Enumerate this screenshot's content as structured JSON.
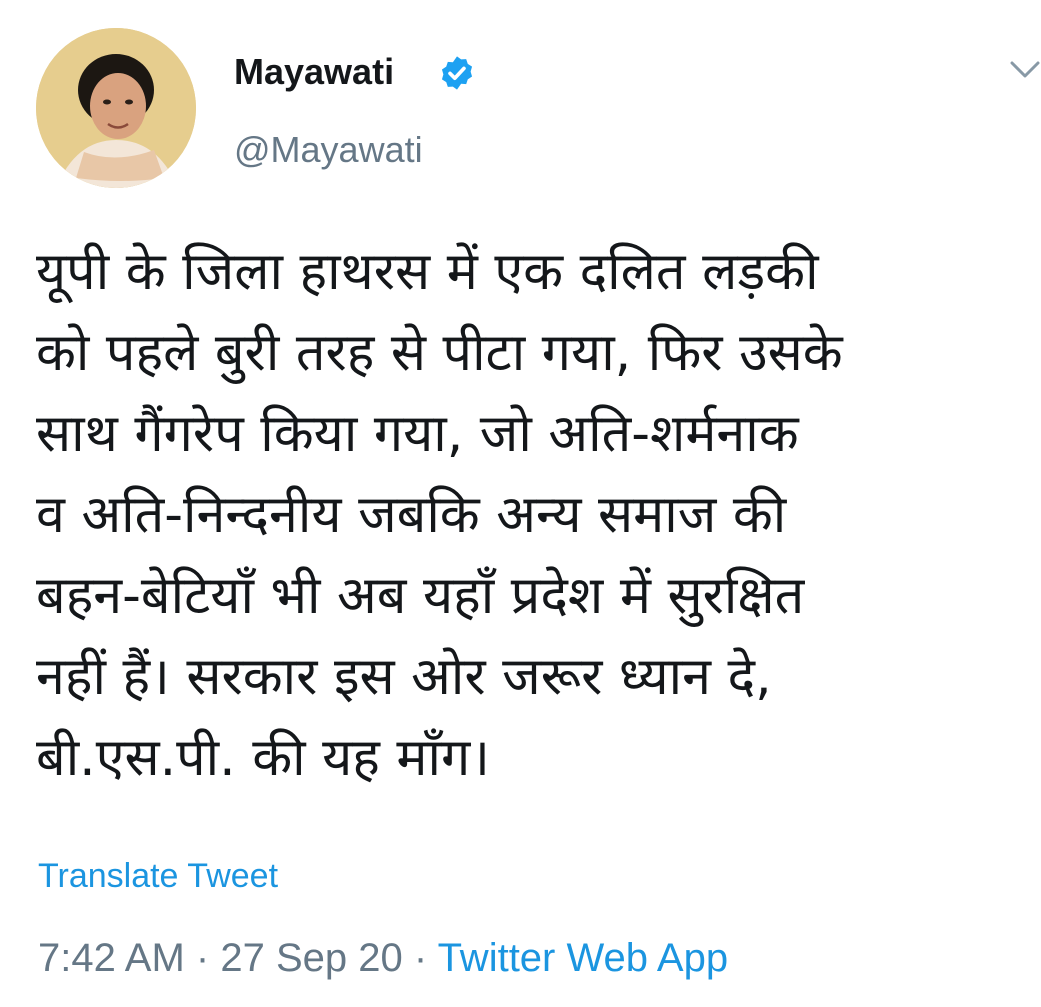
{
  "author": {
    "display_name": "Mayawati",
    "handle": "@Mayawati",
    "verified_icon": "verified-badge-icon",
    "avatar": "profile-photo"
  },
  "menu_icon": "chevron-down-icon",
  "tweet": {
    "lines": [
      "यूपी के जिला हाथरस में एक दलित लड़की",
      "को पहले बुरी तरह से पीटा गया, फिर उसके",
      "साथ गैंगरेप किया गया, जो अति-शर्मनाक",
      "व अति-निन्दनीय जबकि अन्य समाज की",
      "बहन-बेटियाँ भी अब यहाँ प्रदेश में सुरक्षित",
      "नहीं हैं। सरकार इस ओर जरूर ध्यान दे,",
      "बी.एस.पी. की यह माँग।"
    ]
  },
  "translate_label": "Translate Tweet",
  "meta": {
    "time": "7:42 AM",
    "separator": "·",
    "date": "27 Sep 20",
    "source": "Twitter Web App"
  },
  "colors": {
    "link": "#1b95e0",
    "secondary_text": "#657786",
    "primary_text": "#14171a"
  }
}
